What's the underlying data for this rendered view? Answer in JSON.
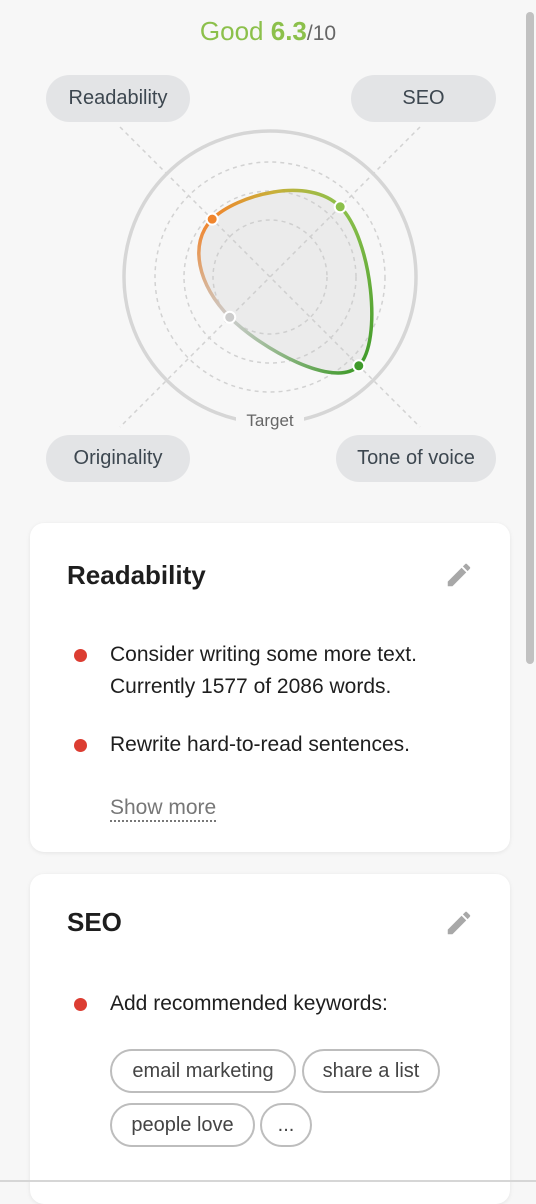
{
  "score": {
    "rating": "Good",
    "value": "6.3",
    "denominator": "/10",
    "color": "#8cc04b"
  },
  "radar": {
    "target_label": "Target",
    "axes": [
      {
        "label": "Readability",
        "level": 0.56,
        "color": "#f0852d"
      },
      {
        "label": "SEO",
        "level": 0.68,
        "color": "#8cc04b"
      },
      {
        "label": "Tone of voice",
        "level": 0.86,
        "color": "#3f9a2a"
      },
      {
        "label": "Originality",
        "level": 0.39,
        "color": "#cccccc"
      }
    ]
  },
  "cards": [
    {
      "title": "Readability",
      "items": [
        "Consider writing some more text. Currently 1577 of 2086 words.",
        "Rewrite hard-to-read sentences."
      ],
      "show_more": "Show more"
    },
    {
      "title": "SEO",
      "items": [
        "Add recommended keywords:"
      ],
      "keywords": [
        "email marketing",
        "share a list",
        "people love",
        "..."
      ]
    }
  ]
}
